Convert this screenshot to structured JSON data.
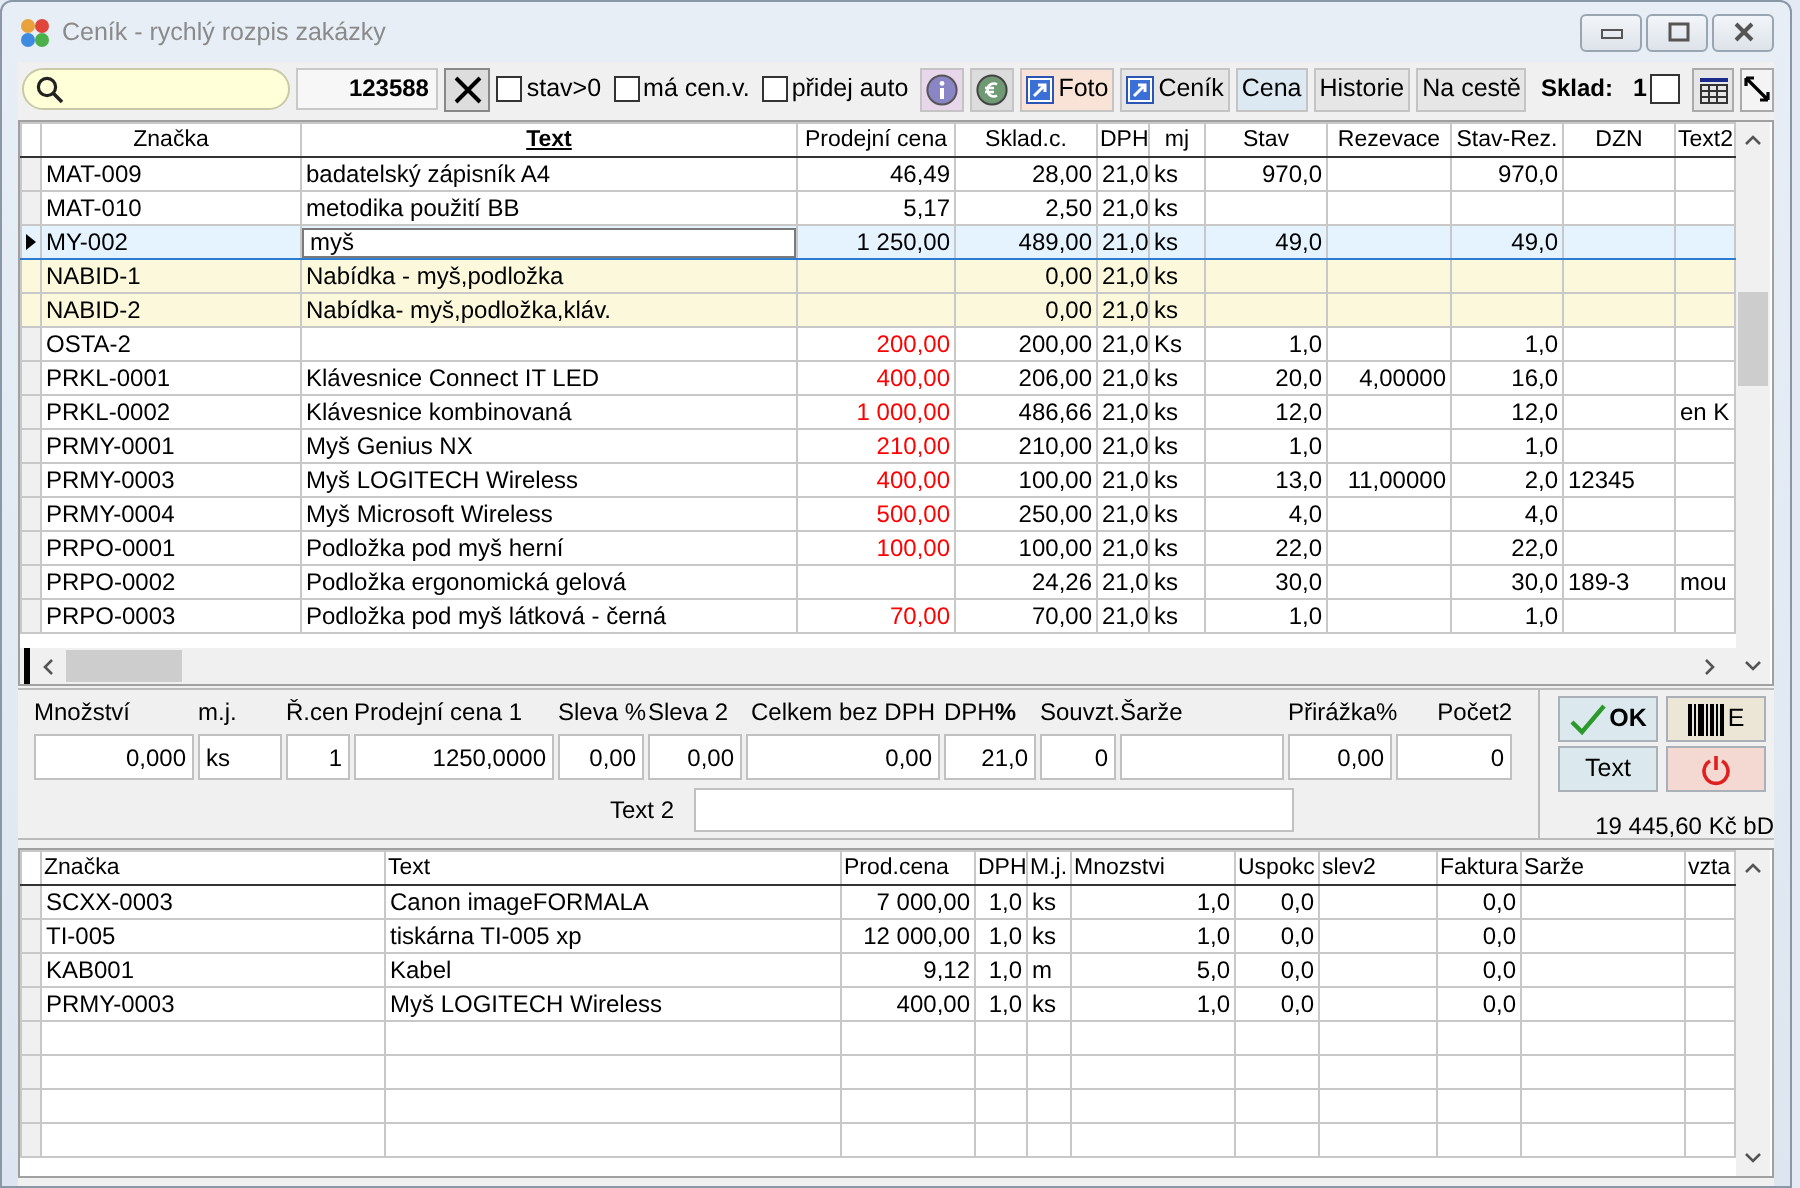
{
  "window": {
    "title": "Ceník - rychlý rozpis zakázky"
  },
  "toolbar": {
    "code": "123588",
    "checkboxes": [
      {
        "label": "stav>0",
        "checked": false
      },
      {
        "label": "má cen.v.",
        "checked": false
      },
      {
        "label": "přidej auto",
        "checked": false
      }
    ],
    "buttons": [
      {
        "kind": "info"
      },
      {
        "kind": "euro"
      },
      {
        "kind": "link",
        "label": "Foto",
        "color": "#f9e2d6"
      },
      {
        "kind": "link",
        "label": "Ceník",
        "color": "#e6e6e6"
      },
      {
        "kind": "text",
        "label": "Cena",
        "color": "#dde9f2"
      },
      {
        "kind": "text",
        "label": "Historie",
        "color": "#e6e6e6"
      },
      {
        "kind": "text",
        "label": "Na cestě",
        "color": "#e6e6e6"
      }
    ],
    "sklad": {
      "label": "Sklad:",
      "value": "1",
      "checked": false
    }
  },
  "price_table": {
    "columns": [
      {
        "label": "Značka",
        "sorted": false
      },
      {
        "label": "Text",
        "sorted": true
      },
      {
        "label": "Prodejní cena",
        "sorted": false
      },
      {
        "label": "Sklad.c.",
        "sorted": false
      },
      {
        "label": "DPH",
        "sorted": false
      },
      {
        "label": "mj",
        "sorted": false
      },
      {
        "label": "Stav",
        "sorted": false
      },
      {
        "label": "Rezevace",
        "sorted": false
      },
      {
        "label": "Stav-Rez.",
        "sorted": false
      },
      {
        "label": "DZN",
        "sorted": false
      },
      {
        "label": "Text2",
        "sorted": false
      }
    ],
    "rows": [
      {
        "kind": "item",
        "selected": false,
        "price_red": false,
        "cells": [
          "MAT-009",
          "badatelský zápisník A4",
          "46,49",
          "28,00",
          "21,0",
          "ks",
          "970,0",
          "",
          "970,0",
          "",
          ""
        ]
      },
      {
        "kind": "item",
        "selected": false,
        "price_red": false,
        "cells": [
          "MAT-010",
          "metodika použití BB",
          "5,17",
          "2,50",
          "21,0",
          "ks",
          "",
          "",
          "",
          "",
          ""
        ]
      },
      {
        "kind": "item",
        "selected": true,
        "price_red": false,
        "cells": [
          "MY-002",
          "myš",
          "1 250,00",
          "489,00",
          "21,0",
          "ks",
          "49,0",
          "",
          "49,0",
          "",
          ""
        ]
      },
      {
        "kind": "offer",
        "selected": false,
        "cells": [
          "NABID-1",
          "Nabídka - myš,podložka",
          "",
          "0,00",
          "21,0",
          "ks",
          "",
          "",
          "",
          "",
          ""
        ]
      },
      {
        "kind": "offer",
        "selected": false,
        "cells": [
          "NABID-2",
          "Nabídka- myš,podložka,kláv.",
          "",
          "0,00",
          "21,0",
          "ks",
          "",
          "",
          "",
          "",
          ""
        ]
      },
      {
        "kind": "item",
        "selected": false,
        "price_red": true,
        "cells": [
          "OSTA-2",
          "",
          "200,00",
          "200,00",
          "21,0",
          "Ks",
          "1,0",
          "",
          "1,0",
          "",
          ""
        ]
      },
      {
        "kind": "item",
        "selected": false,
        "price_red": true,
        "cells": [
          "PRKL-0001",
          "Klávesnice Connect IT LED",
          "400,00",
          "206,00",
          "21,0",
          "ks",
          "20,0",
          "4,00000",
          "16,0",
          "",
          ""
        ]
      },
      {
        "kind": "item",
        "selected": false,
        "price_red": true,
        "cells": [
          "PRKL-0002",
          "Klávesnice kombinovaná",
          "1 000,00",
          "486,66",
          "21,0",
          "ks",
          "12,0",
          "",
          "12,0",
          "",
          "en K"
        ]
      },
      {
        "kind": "item",
        "selected": false,
        "price_red": true,
        "cells": [
          "PRMY-0001",
          "Myš Genius NX",
          "210,00",
          "210,00",
          "21,0",
          "ks",
          "1,0",
          "",
          "1,0",
          "",
          ""
        ]
      },
      {
        "kind": "item",
        "selected": false,
        "price_red": true,
        "cells": [
          "PRMY-0003",
          "Myš LOGITECH Wireless",
          "400,00",
          "100,00",
          "21,0",
          "ks",
          "13,0",
          "11,00000",
          "2,0",
          "12345",
          ""
        ]
      },
      {
        "kind": "item",
        "selected": false,
        "price_red": true,
        "cells": [
          "PRMY-0004",
          "Myš Microsoft Wireless",
          "500,00",
          "250,00",
          "21,0",
          "ks",
          "4,0",
          "",
          "4,0",
          "",
          ""
        ]
      },
      {
        "kind": "item",
        "selected": false,
        "price_red": true,
        "cells": [
          "PRPO-0001",
          "Podložka pod myš herní",
          "100,00",
          "100,00",
          "21,0",
          "ks",
          "22,0",
          "",
          "22,0",
          "",
          ""
        ]
      },
      {
        "kind": "item",
        "selected": false,
        "cells": [
          "PRPO-0002",
          "Podložka ergonomická gelová",
          "",
          "24,26",
          "21,0",
          "ks",
          "30,0",
          "",
          "30,0",
          "189-3",
          "mou"
        ]
      },
      {
        "kind": "item",
        "selected": false,
        "price_red": true,
        "cells": [
          "PRPO-0003",
          "Podložka pod myš látková - černá",
          "70,00",
          "70,00",
          "21,0",
          "ks",
          "1,0",
          "",
          "1,0",
          "",
          ""
        ]
      }
    ]
  },
  "entry_form": {
    "fields": [
      {
        "label": "Množství",
        "value": "0,000"
      },
      {
        "label": "m.j.",
        "value": "ks"
      },
      {
        "label": "Ř.cen",
        "value": "1"
      },
      {
        "label": "Prodejní cena 1",
        "value": "1250,0000"
      },
      {
        "label": "Sleva %",
        "value": "0,00"
      },
      {
        "label": "Sleva 2",
        "value": "0,00"
      },
      {
        "label": "Celkem bez DPH",
        "value": "0,00"
      },
      {
        "label": "DPH**%**",
        "value": "21,0"
      },
      {
        "label": "Souvzt.",
        "value": "0"
      },
      {
        "label": "Šarže"
      },
      {
        "label": "Přirážka%",
        "value": "0,00"
      },
      {
        "label": "Počet2",
        "value": "0"
      }
    ],
    "text2": {
      "label": "Text 2"
    },
    "buttons": [
      {
        "kind": "ok",
        "label": "OK"
      },
      {
        "kind": "barcode",
        "label": "E"
      },
      {
        "kind": "text",
        "label": "Text"
      },
      {
        "kind": "power"
      }
    ],
    "total": "19 445,60 Kč bD"
  },
  "order_table": {
    "columns": [
      "Značka",
      "Text",
      "Prod.cena",
      "DPH",
      "M.j.",
      "Mnozstvi",
      "Uspokc",
      "slev2",
      "Faktura",
      "Sarže",
      "vzta"
    ],
    "rows": [
      [
        "SCXX-0003",
        "Canon imageFORMALA",
        "7 000,00",
        "1,0",
        "ks",
        "1,0",
        "0,0",
        "",
        "0,0",
        "",
        ""
      ],
      [
        "TI-005",
        "tiskárna TI-005 xp",
        "12 000,00",
        "1,0",
        "ks",
        "1,0",
        "0,0",
        "",
        "0,0",
        "",
        ""
      ],
      [
        "KAB001",
        "Kabel",
        "9,12",
        "1,0",
        "m",
        "5,0",
        "0,0",
        "",
        "0,0",
        "",
        ""
      ],
      [
        "PRMY-0003",
        "Myš LOGITECH Wireless",
        "400,00",
        "1,0",
        "ks",
        "1,0",
        "0,0",
        "",
        "0,0",
        "",
        ""
      ]
    ]
  }
}
